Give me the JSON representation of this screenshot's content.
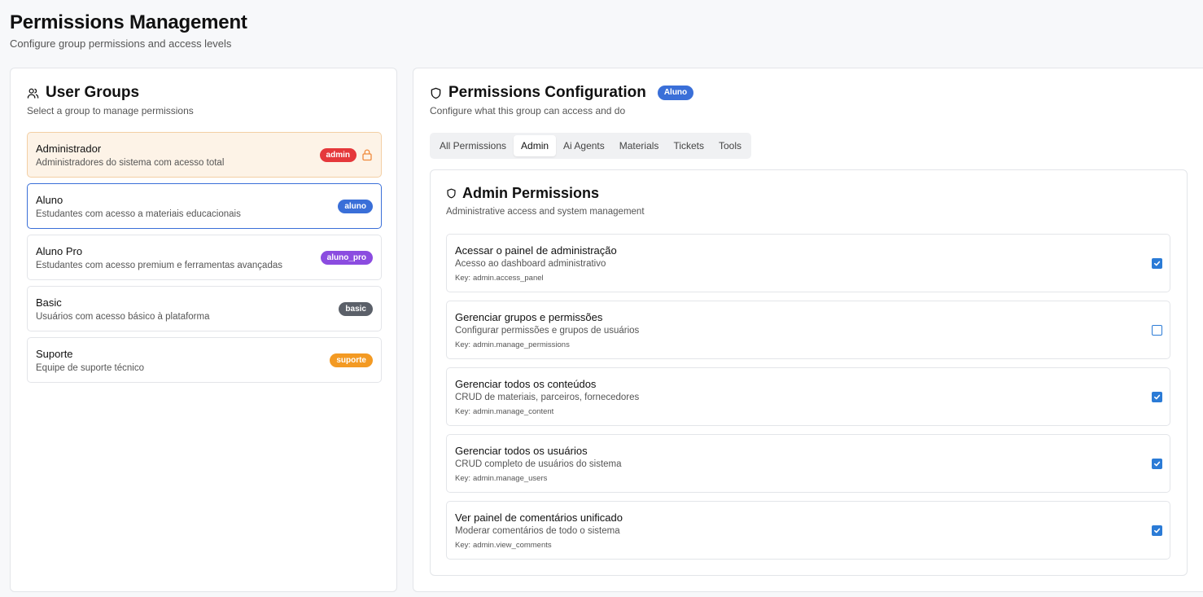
{
  "header": {
    "title": "Permissions Management",
    "subtitle": "Configure group permissions and access levels"
  },
  "user_groups": {
    "title": "User Groups",
    "icon": "users-icon",
    "description": "Select a group to manage permissions",
    "groups": [
      {
        "name": "Administrador",
        "description": "Administradores do sistema com acesso total",
        "badge": "admin",
        "badge_color": "#e5383b",
        "locked": true,
        "lock_icon": "lock-icon"
      },
      {
        "name": "Aluno",
        "description": "Estudantes com acesso a materiais educacionais",
        "badge": "aluno",
        "badge_color": "#3a6fd8",
        "selected": true
      },
      {
        "name": "Aluno Pro",
        "description": "Estudantes com acesso premium e ferramentas avançadas",
        "badge": "aluno_pro",
        "badge_color": "#8b4ce0"
      },
      {
        "name": "Basic",
        "description": "Usuários com acesso básico à plataforma",
        "badge": "basic",
        "badge_color": "#5b6069"
      },
      {
        "name": "Suporte",
        "description": "Equipe de suporte técnico",
        "badge": "suporte",
        "badge_color": "#f39a23"
      }
    ]
  },
  "permissions_config": {
    "title": "Permissions Configuration",
    "icon": "shield-icon",
    "role_badge": "Aluno",
    "description": "Configure what this group can access and do",
    "tabs": [
      {
        "label": "All Permissions",
        "active": false
      },
      {
        "label": "Admin",
        "active": true
      },
      {
        "label": "Ai Agents",
        "active": false
      },
      {
        "label": "Materials",
        "active": false
      },
      {
        "label": "Tickets",
        "active": false
      },
      {
        "label": "Tools",
        "active": false
      }
    ],
    "section": {
      "title": "Admin Permissions",
      "icon": "shield-icon",
      "description": "Administrative access and system management",
      "key_label": "Key:",
      "permissions": [
        {
          "title": "Acessar o painel de administração",
          "description": "Acesso ao dashboard administrativo",
          "key": "admin.access_panel",
          "checked": true
        },
        {
          "title": "Gerenciar grupos e permissões",
          "description": "Configurar permissões e grupos de usuários",
          "key": "admin.manage_permissions",
          "checked": false
        },
        {
          "title": "Gerenciar todos os conteúdos",
          "description": "CRUD de materiais, parceiros, fornecedores",
          "key": "admin.manage_content",
          "checked": true
        },
        {
          "title": "Gerenciar todos os usuários",
          "description": "CRUD completo de usuários do sistema",
          "key": "admin.manage_users",
          "checked": true
        },
        {
          "title": "Ver painel de comentários unificado",
          "description": "Moderar comentários de todo o sistema",
          "key": "admin.view_comments",
          "checked": true
        }
      ]
    }
  },
  "colors": {
    "accent": "#2b7bd6",
    "admin_card_bg": "#fdf3e7",
    "selected_border": "#3a6fd8"
  }
}
